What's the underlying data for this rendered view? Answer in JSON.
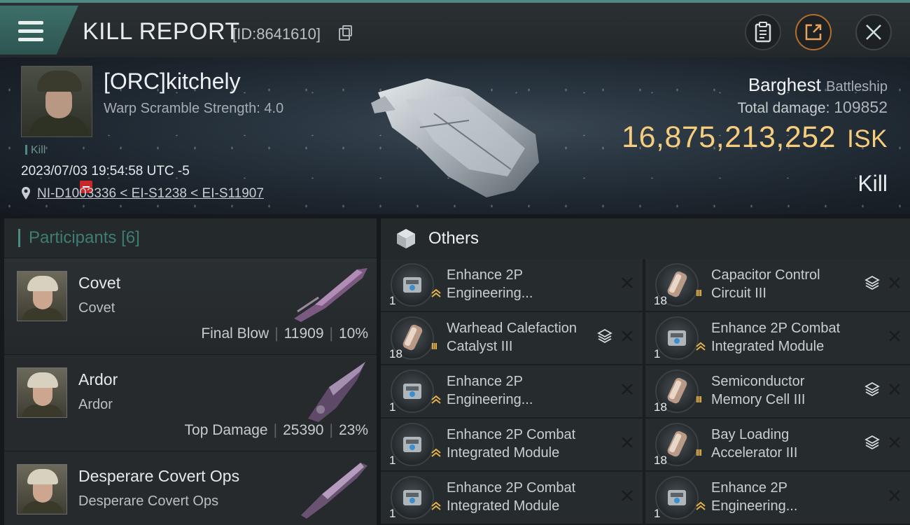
{
  "header": {
    "title": "KILL REPORT",
    "kill_id": "[ID:8641610]"
  },
  "victim": {
    "name": "[ORC]kitchely",
    "scramble": "Warp Scramble Strength: 4.0",
    "tag": "Kill",
    "datetime": "2023/07/03 19:54:58 UTC -5",
    "location": "NI-D1003336 < EI-S1238 < EI-S11907",
    "ship_name": "Barghest",
    "ship_class": "Battleship",
    "total_damage_label": "Total damage:",
    "total_damage": "109852",
    "isk_value": "16,875,213,252",
    "isk_unit": "ISK",
    "result": "Kill"
  },
  "participants": {
    "label": "Participants",
    "count": "[6]",
    "list": [
      {
        "name": "Covet",
        "ship": "Covet",
        "role": "Final Blow",
        "damage": "11909",
        "percent": "10%"
      },
      {
        "name": "Ardor",
        "ship": "Ardor",
        "role": "Top Damage",
        "damage": "25390",
        "percent": "23%"
      },
      {
        "name": "Desperare Covert Ops",
        "ship": "Desperare Covert Ops",
        "role": "",
        "damage": "",
        "percent": ""
      }
    ]
  },
  "others": {
    "label": "Others",
    "items": [
      {
        "qty": "1",
        "line1": "Enhance 2P",
        "line2": "Engineering...",
        "stack": false
      },
      {
        "qty": "18",
        "line1": "Capacitor Control",
        "line2": "Circuit III",
        "stack": true
      },
      {
        "qty": "18",
        "line1": "Warhead Calefaction",
        "line2": "Catalyst III",
        "stack": true
      },
      {
        "qty": "1",
        "line1": "Enhance 2P Combat",
        "line2": "Integrated Module",
        "stack": false
      },
      {
        "qty": "1",
        "line1": "Enhance 2P",
        "line2": "Engineering...",
        "stack": false
      },
      {
        "qty": "18",
        "line1": "Semiconductor",
        "line2": "Memory Cell III",
        "stack": true
      },
      {
        "qty": "1",
        "line1": "Enhance 2P Combat",
        "line2": "Integrated Module",
        "stack": false
      },
      {
        "qty": "18",
        "line1": "Bay Loading",
        "line2": "Accelerator III",
        "stack": true
      },
      {
        "qty": "1",
        "line1": "Enhance 2P Combat",
        "line2": "Integrated Module",
        "stack": false
      },
      {
        "qty": "1",
        "line1": "Enhance 2P",
        "line2": "Engineering...",
        "stack": false
      }
    ]
  },
  "colors": {
    "accent": "#4f8a82",
    "isk": "#f5cd7d",
    "share_ring": "#b36e2a",
    "tier": "#e7b24a"
  }
}
